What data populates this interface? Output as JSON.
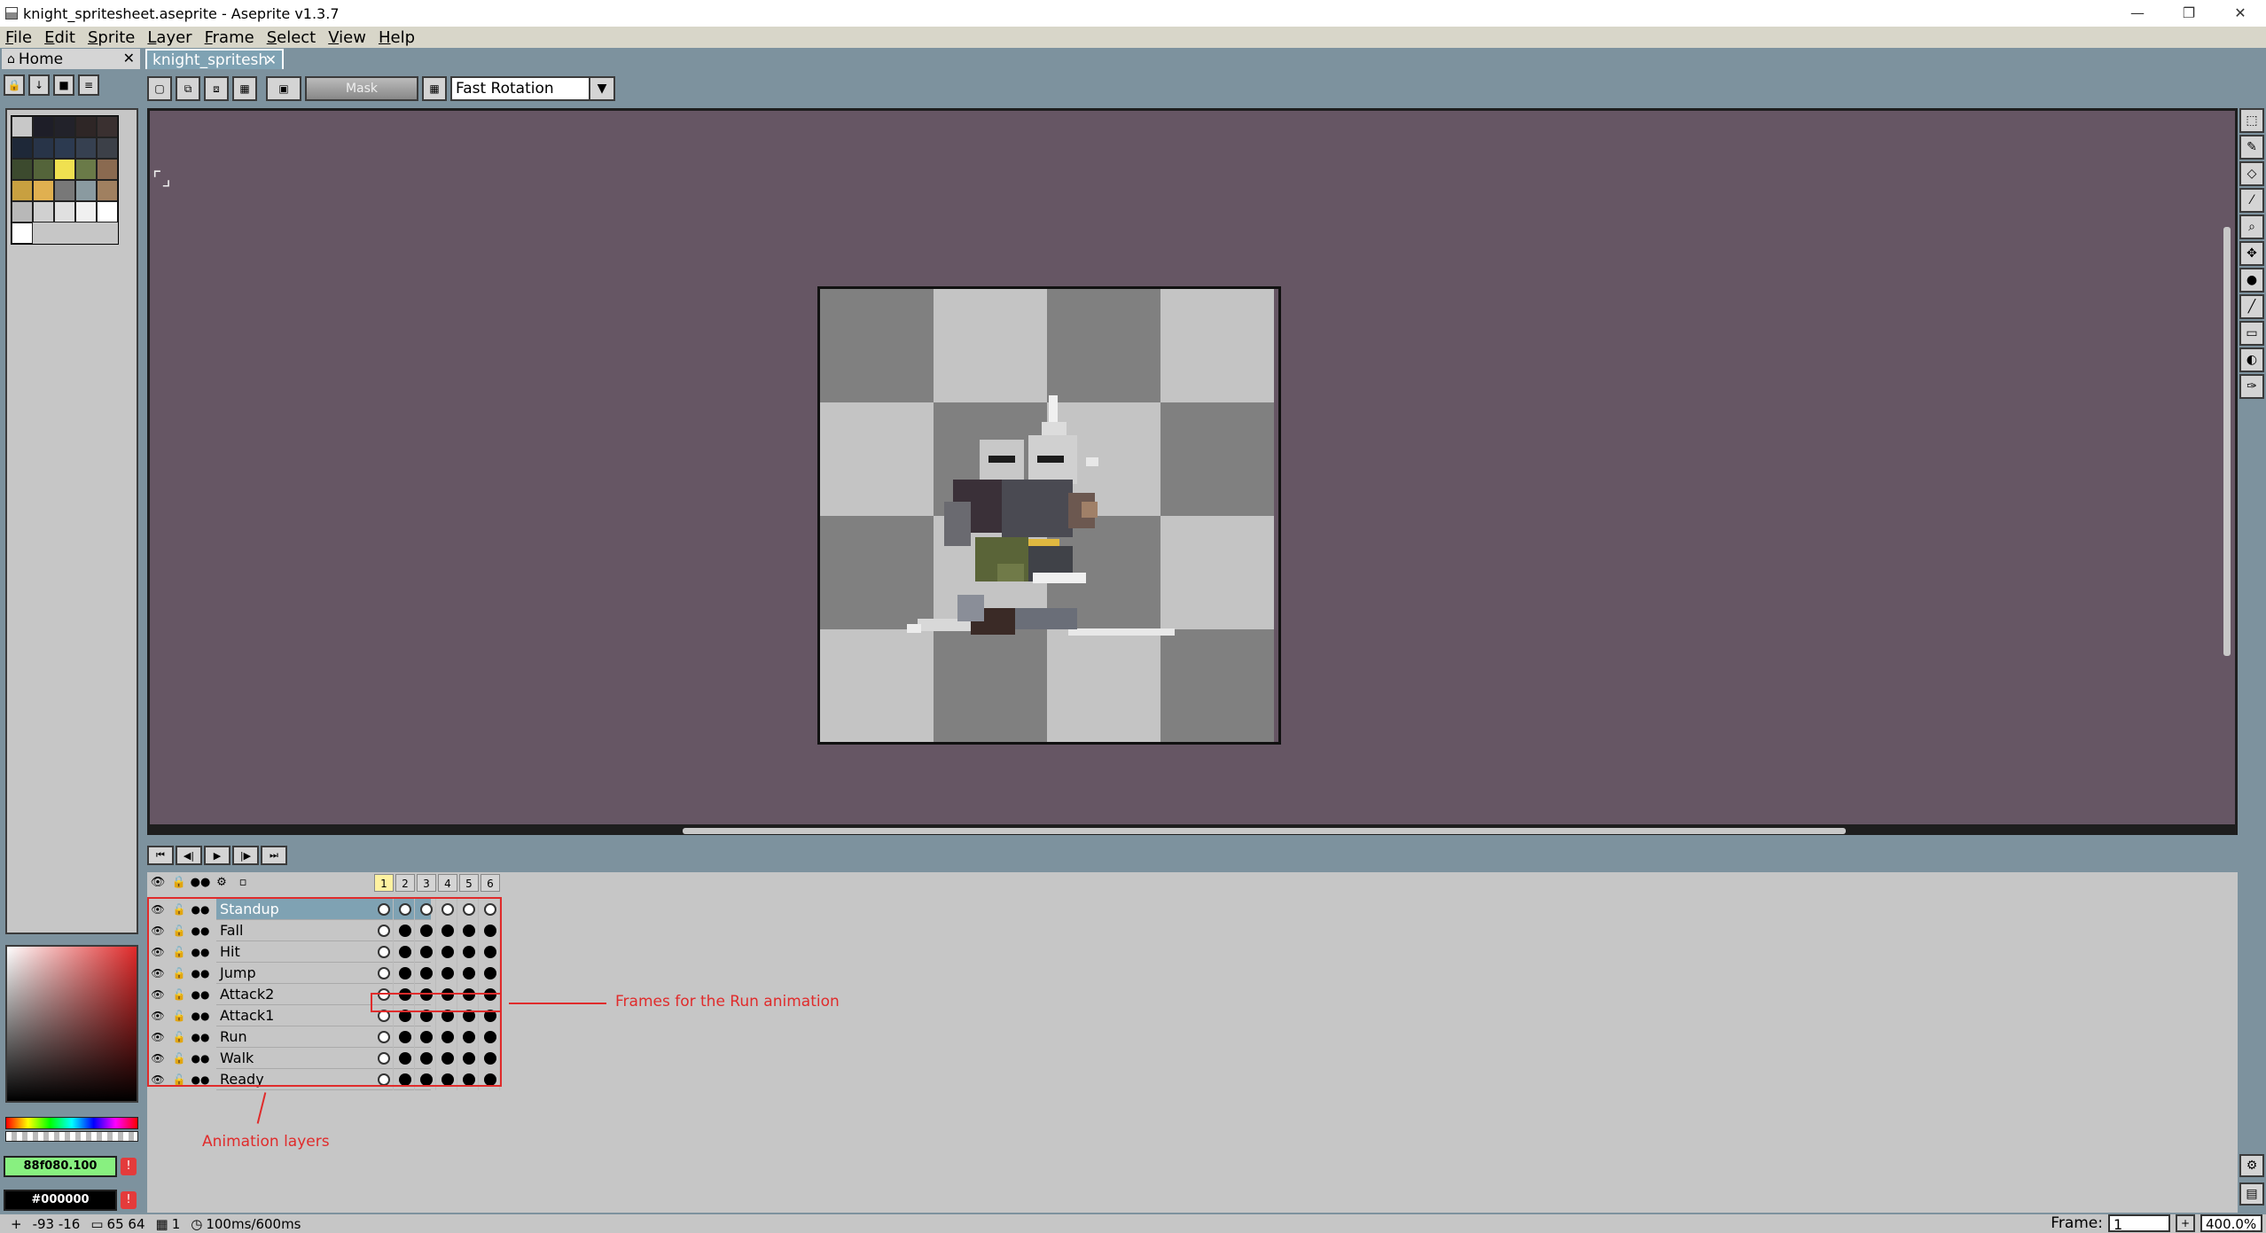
{
  "window": {
    "title": "knight_spritesheet.aseprite - Aseprite v1.3.7",
    "minimize": "—",
    "restore": "❐",
    "close": "✕"
  },
  "menu": [
    "File",
    "Edit",
    "Sprite",
    "Layer",
    "Frame",
    "Select",
    "View",
    "Help"
  ],
  "tabs": {
    "home": "Home",
    "file": "knight_spritesh",
    "close_glyph": "✕"
  },
  "contextbar": {
    "mask_label": "Mask",
    "rotation_algorithm": "Fast Rotation"
  },
  "palette": {
    "swatches": [
      "#c8c8c8",
      "#1e1e28",
      "#22222a",
      "#2e2626",
      "#3a3030",
      "#1e2838",
      "#283448",
      "#2c3a50",
      "#364050",
      "#3c4048",
      "#3c4a2e",
      "#54643a",
      "#f0e050",
      "#6a7a48",
      "#8a6a50",
      "#c8a040",
      "#e0b050",
      "#787878",
      "#8a9aa0",
      "#a08060",
      "#b8b8b8",
      "#d0d0d0",
      "#e0e0e0",
      "#f0f0f0",
      "#ffffff",
      "#ffffff"
    ]
  },
  "colors": {
    "foreground": "88f080.100",
    "background": "#000000",
    "accent": "#7fa2b3",
    "annotation": "#e02b2b",
    "canvas_bg": "#665664"
  },
  "timeline": {
    "frames": [
      "1",
      "2",
      "3",
      "4",
      "5",
      "6"
    ],
    "current_frame": 1,
    "layers": [
      {
        "name": "Standup",
        "selected": true,
        "cels": [
          0,
          0,
          0,
          0,
          0,
          0
        ]
      },
      {
        "name": "Fall",
        "selected": false,
        "cels": [
          0,
          1,
          1,
          1,
          1,
          1
        ]
      },
      {
        "name": "Hit",
        "selected": false,
        "cels": [
          0,
          1,
          1,
          1,
          1,
          1
        ]
      },
      {
        "name": "Jump",
        "selected": false,
        "cels": [
          0,
          1,
          1,
          1,
          1,
          1
        ]
      },
      {
        "name": "Attack2",
        "selected": false,
        "cels": [
          0,
          1,
          1,
          1,
          1,
          1
        ]
      },
      {
        "name": "Attack1",
        "selected": false,
        "cels": [
          0,
          1,
          1,
          1,
          1,
          1
        ]
      },
      {
        "name": "Run",
        "selected": false,
        "cels": [
          0,
          1,
          1,
          1,
          1,
          1
        ]
      },
      {
        "name": "Walk",
        "selected": false,
        "cels": [
          0,
          1,
          1,
          1,
          1,
          1
        ]
      },
      {
        "name": "Ready",
        "selected": false,
        "cels": [
          0,
          1,
          1,
          1,
          1,
          1
        ]
      }
    ]
  },
  "annotations": {
    "frames_note": "Frames for the Run animation",
    "layers_note": "Animation layers"
  },
  "status": {
    "coords": "-93 -16",
    "size": "65 64",
    "frame_count": "1",
    "duration": "100ms/600ms"
  },
  "footer": {
    "frame_label": "Frame:",
    "frame_value": "1",
    "zoom": "400.0%"
  }
}
